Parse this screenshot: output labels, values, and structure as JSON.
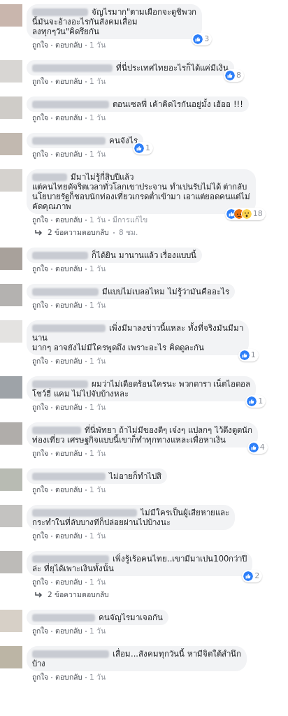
{
  "comments": [
    {
      "text": "จัญไรมาก\"ตามเผือกจะดูชิพวก\nนี้มันจะอ้างอะไรกันสังคมเสื่อม\nลงทุกๆวัน\"คิดรึยกัน",
      "reactions": {
        "icons": [
          {
            "kind": "like"
          }
        ],
        "count": "3"
      },
      "actions": [
        "ถูกใจ",
        "ตอบกลับ",
        "1 วัน"
      ]
    },
    {
      "text": "ที่นี่ประเทศไทยอะไรก็ได้แค่มีเงิน",
      "reactions": {
        "icons": [
          {
            "kind": "like"
          }
        ],
        "count": "8"
      },
      "actions": [
        "ถูกใจ",
        "ตอบกลับ",
        "1 วัน"
      ]
    },
    {
      "text": "ตอนเซลฟี่ เค้าคิดไรกันอยู่มั้ง เฮ้ออ !!!",
      "actions": [
        "ถูกใจ",
        "ตอบกลับ",
        "1 วัน"
      ]
    },
    {
      "text": "คนจังไร",
      "reactions": {
        "icons": [
          {
            "kind": "like"
          }
        ],
        "count": "1"
      },
      "actions": [
        "ถูกใจ",
        "ตอบกลับ",
        "1 วัน"
      ]
    },
    {
      "text": "มีมาไม่รู้กี่สิบปีแล้ว\nแต่คนไทยดัจริตเวลาทั่วโลกเขาประจาน ทำเปนรับไม่ได้ ต่ากลับ\nนโยบายรัฐก็ชอบนักท่องเที่ยวเกรดต่ำเข้ามา เอาแต่ยอดคนแต่ไม่\nคัดคุณภาพ",
      "reactions": {
        "icons": [
          {
            "kind": "like"
          },
          {
            "kind": "angry"
          },
          {
            "kind": "wow"
          }
        ],
        "count": "18"
      },
      "actions": [
        "ถูกใจ",
        "ตอบกลับ",
        "1 วัน",
        "มีการแก้ไข"
      ],
      "replies": {
        "label": "2 ข้อความตอบกลับ",
        "time": "8 ชม."
      }
    },
    {
      "text": "ก็ได้ยิน มานานแล้ว เรื่องแบบนี้",
      "actions": [
        "ถูกใจ",
        "ตอบกลับ",
        "1 วัน"
      ]
    },
    {
      "text": "มีแบบไม่เบลอไหม ไม่รู้ว่ามันคืออะไร",
      "actions": [
        "ถูกใจ",
        "ตอบกลับ",
        "1 วัน"
      ]
    },
    {
      "text": "เพิ่งมีมาลงข่าวนี้แหละ ทั้งที่จริงมันมีมา\nนาน\nมากๆ อาจยังไม่มีใครพูดถึง เพราะอะไร คิดดูละกัน",
      "reactions": {
        "icons": [
          {
            "kind": "like"
          }
        ],
        "count": "1"
      },
      "actions": [
        "ถูกใจ",
        "ตอบกลับ",
        "1 วัน"
      ]
    },
    {
      "text": "ผมว่าไม่เดือดร้อนใครนะ พวกดารา เน็ตไอดอล\nโชว์ฮี่ แคม ไม่ไปจับบ้างหละ",
      "reactions": {
        "icons": [
          {
            "kind": "like"
          }
        ],
        "count": "1"
      },
      "actions": [
        "ถูกใจ",
        "ตอบกลับ",
        "1 วัน"
      ]
    },
    {
      "text": "ที่นี่พัทยา ถ้าไม่มีของดีๆ เจ๋งๆ แปลกๆ ไว้ดึงดูดนัก\nท่องเที่ยว เศรษฐกิจแบบนี้เขาก็ทำทุกทางแหละเพื่อหาเงิน",
      "reactions": {
        "icons": [
          {
            "kind": "like"
          }
        ],
        "count": "4"
      },
      "actions": [
        "ถูกใจ",
        "ตอบกลับ",
        "1 วัน"
      ]
    },
    {
      "text": "ไม่อายก็ทำไปสิ",
      "actions": [
        "ถูกใจ",
        "ตอบกลับ",
        "1 วัน"
      ]
    },
    {
      "text": "ไม่มีใครเป็นผู้เสียหายและ\nกระทำในที่ลับบางทีก็ปล่อยผ่านไปบ้างนะ",
      "actions": [
        "ถูกใจ",
        "ตอบกลับ",
        "1 วัน"
      ]
    },
    {
      "text": "เพิ่งรู้เร้อคนไทย..เขามีมาเปน100กว่าปี\nล่ะ ที่ยุได้เพาะเงินทั้งนั้น",
      "reactions": {
        "icons": [
          {
            "kind": "like"
          }
        ],
        "count": "2"
      },
      "actions": [
        "ถูกใจ",
        "ตอบกลับ",
        "1 วัน"
      ],
      "replies": {
        "label": "2 ข้อความตอบกลับ"
      }
    },
    {
      "text": "คนจัญไรมาเจอกัน",
      "actions": [
        "ถูกใจ",
        "ตอบกลับ",
        "1 วัน"
      ]
    },
    {
      "text": "เสื่อม...สังคมทุกวันนี้ หามีจิตใต้สำนึก\nบ้าง",
      "actions": [
        "ถูกใจ",
        "ตอบกลับ",
        "1 วัน"
      ]
    }
  ]
}
